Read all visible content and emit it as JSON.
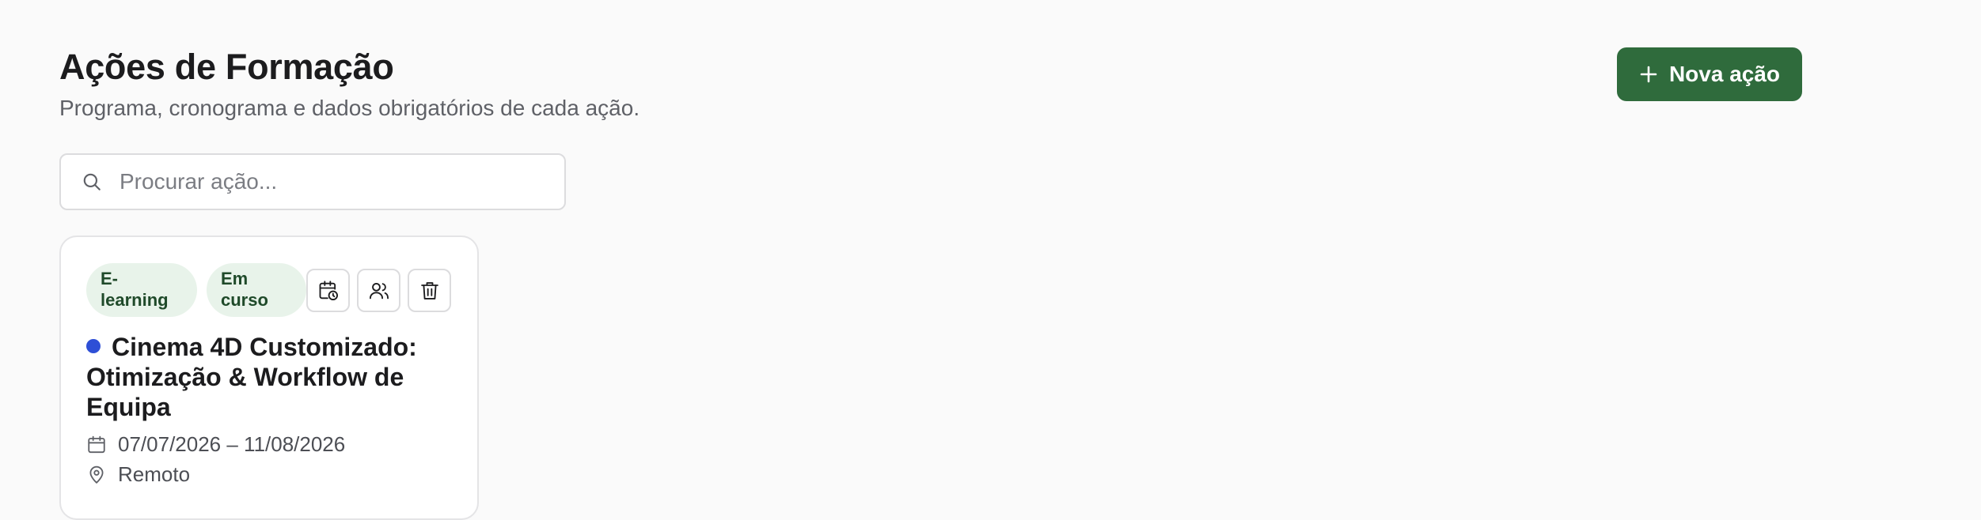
{
  "header": {
    "title": "Ações de Formação",
    "subtitle": "Programa, cronograma e dados obrigatórios de cada ação."
  },
  "toolbar": {
    "new_action_label": "Nova ação",
    "accent_color": "#2f6b3c"
  },
  "search": {
    "placeholder": "Procurar ação...",
    "value": ""
  },
  "actions": [
    {
      "badges": [
        "E-learning",
        "Em curso"
      ],
      "title": "Cinema 4D Customizado: Otimização & Workflow de Equipa",
      "status_color": "#2e4fd6",
      "dates": "07/07/2026 – 11/08/2026",
      "location": "Remoto",
      "buttons": [
        "schedule-icon",
        "users-icon",
        "trash-icon"
      ]
    }
  ]
}
